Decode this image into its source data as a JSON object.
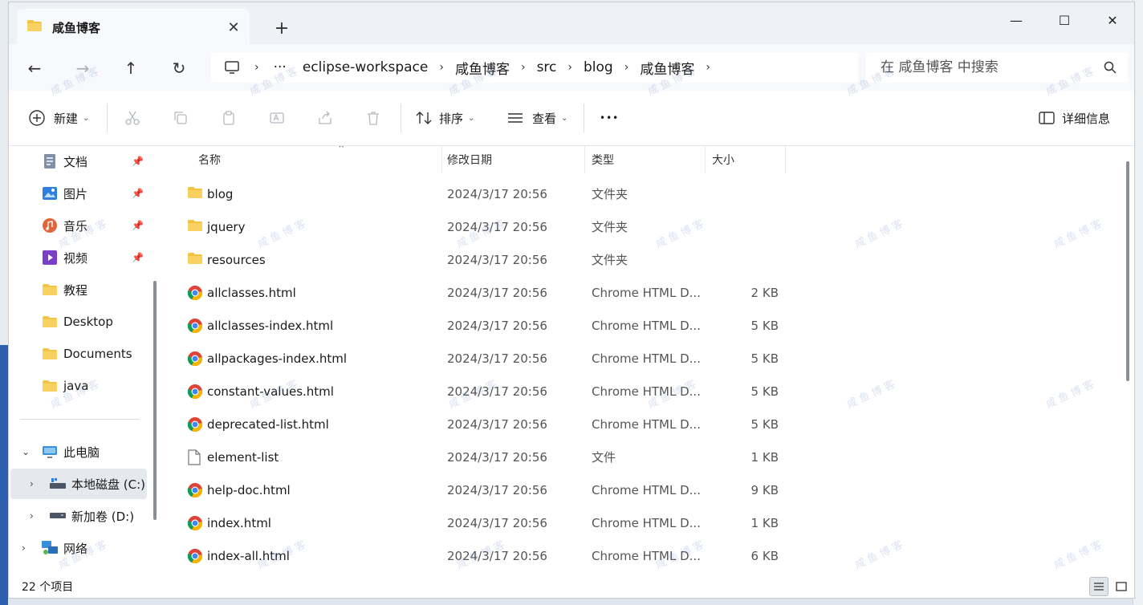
{
  "window": {
    "tab_title": "咸鱼博客",
    "tab_close_glyph": "✕",
    "new_tab_glyph": "+",
    "minimize_glyph": "—",
    "maximize_glyph": "☐",
    "close_glyph": "✕"
  },
  "nav": {
    "back_glyph": "←",
    "forward_glyph": "→",
    "up_glyph": "↑",
    "refresh_glyph": "↻"
  },
  "breadcrumb": {
    "more": "···",
    "items": [
      "eclipse-workspace",
      "咸鱼博客",
      "src",
      "blog",
      "咸鱼博客"
    ]
  },
  "search": {
    "placeholder": "在 咸鱼博客 中搜索"
  },
  "toolbar": {
    "new_label": "新建",
    "sort_label": "排序",
    "view_label": "查看",
    "more_glyph": "•••",
    "details_label": "详细信息"
  },
  "sidebar": {
    "quick": [
      {
        "label": "文档",
        "icon": "document-icon",
        "pinned": true
      },
      {
        "label": "图片",
        "icon": "picture-icon",
        "pinned": true
      },
      {
        "label": "音乐",
        "icon": "music-icon",
        "pinned": true
      },
      {
        "label": "视频",
        "icon": "video-icon",
        "pinned": true
      },
      {
        "label": "教程",
        "icon": "folder-icon",
        "pinned": false
      },
      {
        "label": "Desktop",
        "icon": "folder-icon",
        "pinned": false
      },
      {
        "label": "Documents",
        "icon": "folder-icon",
        "pinned": false
      },
      {
        "label": "java",
        "icon": "folder-icon",
        "pinned": false
      }
    ],
    "pin_glyph": "📌",
    "this_pc": "此电脑",
    "drive_c": "本地磁盘 (C:)",
    "drive_d": "新加卷 (D:)",
    "network": "网络"
  },
  "columns": {
    "name": "名称",
    "date": "修改日期",
    "type": "类型",
    "size": "大小"
  },
  "files": [
    {
      "name": "blog",
      "date": "2024/3/17 20:56",
      "type": "文件夹",
      "size": "",
      "icon": "folder"
    },
    {
      "name": "jquery",
      "date": "2024/3/17 20:56",
      "type": "文件夹",
      "size": "",
      "icon": "folder"
    },
    {
      "name": "resources",
      "date": "2024/3/17 20:56",
      "type": "文件夹",
      "size": "",
      "icon": "folder"
    },
    {
      "name": "allclasses.html",
      "date": "2024/3/17 20:56",
      "type": "Chrome HTML D...",
      "size": "2 KB",
      "icon": "chrome"
    },
    {
      "name": "allclasses-index.html",
      "date": "2024/3/17 20:56",
      "type": "Chrome HTML D...",
      "size": "5 KB",
      "icon": "chrome"
    },
    {
      "name": "allpackages-index.html",
      "date": "2024/3/17 20:56",
      "type": "Chrome HTML D...",
      "size": "5 KB",
      "icon": "chrome"
    },
    {
      "name": "constant-values.html",
      "date": "2024/3/17 20:56",
      "type": "Chrome HTML D...",
      "size": "5 KB",
      "icon": "chrome"
    },
    {
      "name": "deprecated-list.html",
      "date": "2024/3/17 20:56",
      "type": "Chrome HTML D...",
      "size": "5 KB",
      "icon": "chrome"
    },
    {
      "name": "element-list",
      "date": "2024/3/17 20:56",
      "type": "文件",
      "size": "1 KB",
      "icon": "file"
    },
    {
      "name": "help-doc.html",
      "date": "2024/3/17 20:56",
      "type": "Chrome HTML D...",
      "size": "9 KB",
      "icon": "chrome"
    },
    {
      "name": "index.html",
      "date": "2024/3/17 20:56",
      "type": "Chrome HTML D...",
      "size": "1 KB",
      "icon": "chrome"
    },
    {
      "name": "index-all.html",
      "date": "2024/3/17 20:56",
      "type": "Chrome HTML D...",
      "size": "6 KB",
      "icon": "chrome"
    }
  ],
  "status": {
    "count": "22 个项目"
  },
  "colors": {
    "folder": "#f3c343",
    "folder_dark": "#e0a92a",
    "accent": "#2d5fb0",
    "selected_bg": "#e5e9ee"
  }
}
